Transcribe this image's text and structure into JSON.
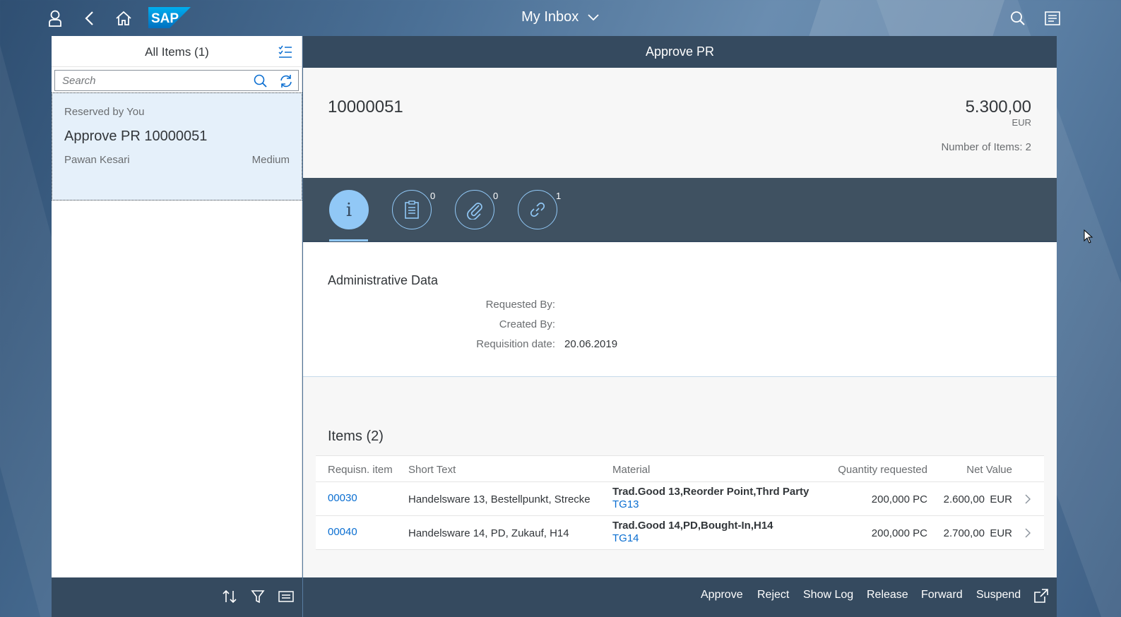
{
  "shell": {
    "title": "My Inbox",
    "logo_text": "SAP",
    "icons": [
      "user-icon",
      "back-icon",
      "home-icon",
      "search-icon",
      "notifications-icon"
    ],
    "colors": {
      "shell_bg": "#4a6f95",
      "brand": "#0a6ed1"
    }
  },
  "master": {
    "title": "All Items (1)",
    "search_placeholder": "Search",
    "items": [
      {
        "status": "Reserved by You",
        "title": "Approve PR 10000051",
        "creator": "Pawan Kesari",
        "priority": "Medium"
      }
    ]
  },
  "detail": {
    "header_title": "Approve PR",
    "object_title": "10000051",
    "amount": "5.300,00",
    "currency": "EUR",
    "items_count_attr": "Number of Items: 2",
    "tabs": [
      {
        "name": "info",
        "count": ""
      },
      {
        "name": "notes",
        "count": "0"
      },
      {
        "name": "attachments",
        "count": "0"
      },
      {
        "name": "related-objects",
        "count": "1"
      }
    ],
    "admin": {
      "title": "Administrative Data",
      "fields": [
        {
          "label": "Requested By:",
          "value": ""
        },
        {
          "label": "Created By:",
          "value": ""
        },
        {
          "label": "Requisition date:",
          "value": "20.06.2019"
        }
      ]
    },
    "items_section": {
      "title": "Items (2)",
      "columns": [
        "Requisn. item",
        "Short Text",
        "Material",
        "Quantity requested",
        "Net Value"
      ],
      "rows": [
        {
          "item": "00030",
          "short_text": "Handelsware 13, Bestellpunkt, Strecke",
          "material_name": "Trad.Good 13,Reorder Point,Thrd Party",
          "material_id": "TG13",
          "quantity": "200,000 PC",
          "net_value": "2.600,00",
          "currency": "EUR"
        },
        {
          "item": "00040",
          "short_text": "Handelsware 14, PD, Zukauf, H14",
          "material_name": "Trad.Good 14,PD,Bought-In,H14",
          "material_id": "TG14",
          "quantity": "200,000 PC",
          "net_value": "2.700,00",
          "currency": "EUR"
        }
      ]
    },
    "footer_actions": {
      "approve": "Approve",
      "reject": "Reject",
      "show_log": "Show Log",
      "release": "Release",
      "forward": "Forward",
      "suspend": "Suspend"
    }
  }
}
